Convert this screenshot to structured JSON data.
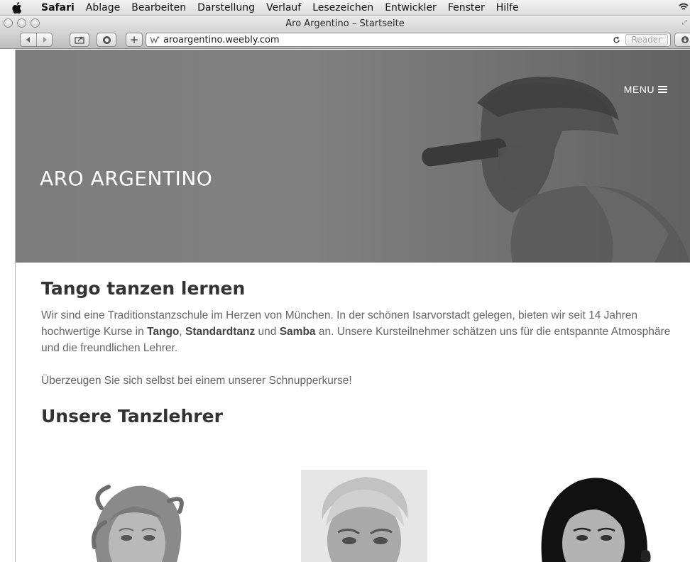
{
  "menubar": {
    "app_name": "Safari",
    "items": [
      "Ablage",
      "Bearbeiten",
      "Darstellung",
      "Verlauf",
      "Lesezeichen",
      "Entwickler",
      "Fenster",
      "Hilfe"
    ],
    "apple_icon": "apple-icon",
    "wifi_icon": "wifi-icon"
  },
  "window": {
    "title": "Aro Argentino – Startseite"
  },
  "toolbar": {
    "url": "aroargentino.weebly.com",
    "reader_label": "Reader",
    "add_label": "+",
    "site_icon": "weebly-icon"
  },
  "hero": {
    "menu_label": "MENU",
    "site_title": "ARO ARGENTINO"
  },
  "main": {
    "heading": "Tango tanzen lernen",
    "intro": {
      "part1": "Wir sind eine Traditionstanzschule im Herzen von München. In der schönen Isarvorstadt gelegen, bieten wir seit 14 Jahren hochwertige Kurse in ",
      "bold1": "Tango",
      "sep1": ", ",
      "bold2": "Standardtanz",
      "sep2": " und ",
      "bold3": "Samba",
      "part2": " an. Unsere Kursteilnehmer schätzen uns für die entspannte Atmosphäre und die freundlichen Lehrer."
    },
    "cta": "Überzeugen Sie sich selbst bei einem unserer Schnupperkurse!",
    "teachers_heading": "Unsere Tanzlehrer"
  },
  "colors": {
    "hero_gray": "#7b7b7b",
    "heading_text": "#333333",
    "body_text": "#666666"
  }
}
